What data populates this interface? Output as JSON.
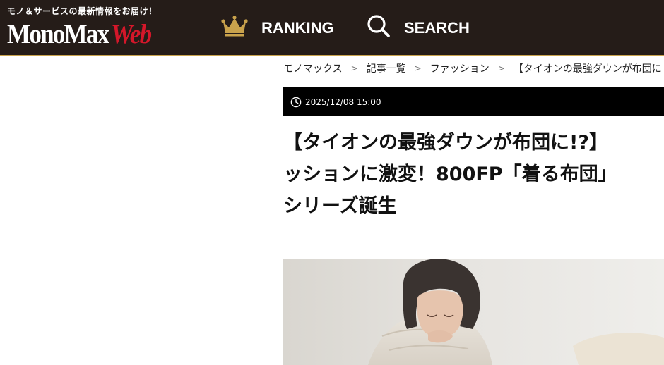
{
  "header": {
    "tagline": "モノ＆サービスの最新情報をお届け！",
    "logo_primary": "MonoMax",
    "logo_secondary": "Web",
    "nav": [
      {
        "label": "RANKING",
        "icon": "crown-icon"
      },
      {
        "label": "SEARCH",
        "icon": "search-icon"
      }
    ],
    "colors": {
      "background": "#251c18",
      "accent": "#c9a24c",
      "logo_red": "#d4172a"
    }
  },
  "breadcrumb": {
    "items": [
      "モノマックス",
      "記事一覧",
      "ファッション"
    ],
    "separator": ">",
    "current": "【タイオンの最強ダウンが布団に"
  },
  "article": {
    "date": "2025/12/08 15:00",
    "title_lines": [
      "【タイオンの最強ダウンが布団に!?】",
      "ッションに激変！800FP「着る布団」",
      "シリーズ誕生"
    ]
  }
}
